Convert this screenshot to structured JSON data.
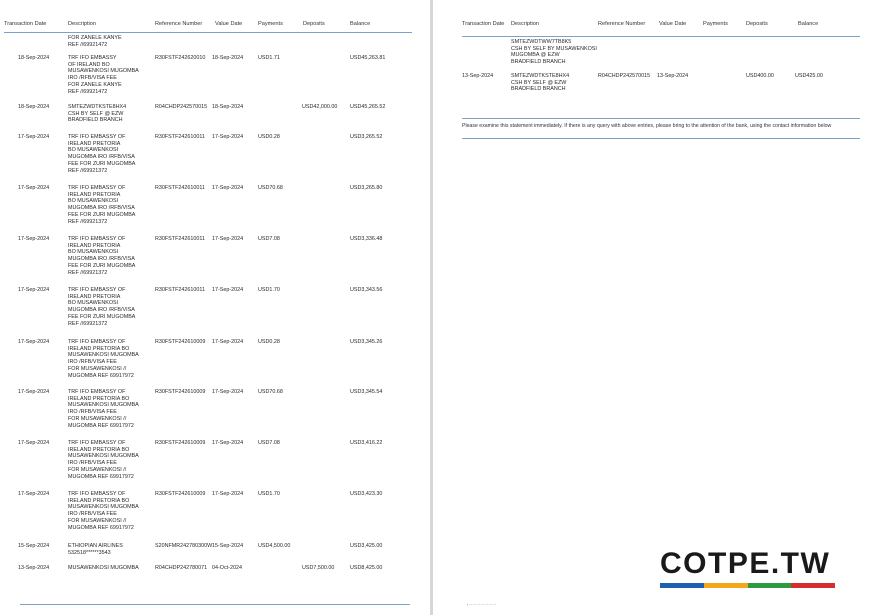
{
  "headers": {
    "date": "Transaction Date",
    "desc": "Description",
    "ref": "Reference Number",
    "value": "Value Date",
    "pay": "Payments",
    "dep": "Deposits",
    "bal": "Balance"
  },
  "left_page": {
    "continued_desc": "FOR ZANELE KANYE\nREF //69921472",
    "rows": [
      {
        "date": "18-Sep-2024",
        "desc": "TRF IFO EMBASSY\nOF IRELAND BO\nMUSAWENKOSI MUGOMBA\nIRO /RFB/VISA FEE\nFOR ZANELE KANYE\nREF //69921472",
        "ref": "R30FSTF242620010",
        "value": "18-Sep-2024",
        "pay": "USD1.71",
        "dep": "",
        "bal": "USD45,263.81"
      },
      {
        "date": "18-Sep-2024",
        "desc": "SMTEZWDTKSTE8HX4\nCSH BY SELF @ EZW\nBRADFIELD BRANCH",
        "ref": "R04CHDP242570015",
        "value": "18-Sep-2024",
        "pay": "",
        "dep": "USD42,000.00",
        "bal": "USD45,265.52"
      },
      {
        "date": "17-Sep-2024",
        "desc": "TRF IFO EMBASSY OF\nIRELAND PRETORIA\nBO MUSAWENKOSI\nMUGOMBA IRO /RFB/VISA\nFEE FOR ZURI MUGOMBA\nREF //69921372",
        "ref": "R30FSTF242610011",
        "value": "17-Sep-2024",
        "pay": "USD0.28",
        "dep": "",
        "bal": "USD3,265.52"
      },
      {
        "date": "17-Sep-2024",
        "desc": "TRF IFO EMBASSY OF\nIRELAND PRETORIA\nBO MUSAWENKOSI\nMUGOMBA IRO /RFB/VISA\nFEE FOR ZURI MUGOMBA\nREF //69921372",
        "ref": "R30FSTF242610011",
        "value": "17-Sep-2024",
        "pay": "USD70.68",
        "dep": "",
        "bal": "USD3,265.80"
      },
      {
        "date": "17-Sep-2024",
        "desc": "TRF IFO EMBASSY OF\nIRELAND PRETORIA\nBO MUSAWENKOSI\nMUGOMBA IRO /RFB/VISA\nFEE FOR ZURI MUGOMBA\nREF //69921372",
        "ref": "R30FSTF242610011",
        "value": "17-Sep-2024",
        "pay": "USD7.08",
        "dep": "",
        "bal": "USD3,336.48"
      },
      {
        "date": "17-Sep-2024",
        "desc": "TRF IFO EMBASSY OF\nIRELAND PRETORIA\nBO MUSAWENKOSI\nMUGOMBA IRO /RFB/VISA\nFEE FOR ZURI MUGOMBA\nREF //69921372",
        "ref": "R30FSTF242610011",
        "value": "17-Sep-2024",
        "pay": "USD1.70",
        "dep": "",
        "bal": "USD3,343.56"
      },
      {
        "date": "17-Sep-2024",
        "desc": "TRF IFO EMBASSY OF\nIRELAND PRETORIA BO\nMUSAWENKOSI MUGOMBA\nIRO /RFB/VISA FEE\nFOR MUSAWENKOSI //\nMUGOMBA REF 69917972",
        "ref": "R30FSTF242610009",
        "value": "17-Sep-2024",
        "pay": "USD0.28",
        "dep": "",
        "bal": "USD3,345.26"
      },
      {
        "date": "17-Sep-2024",
        "desc": "TRF IFO EMBASSY OF\nIRELAND PRETORIA BO\nMUSAWENKOSI MUGOMBA\nIRO /RFB/VISA FEE\nFOR MUSAWENKOSI //\nMUGOMBA REF 69917972",
        "ref": "R30FSTF242610009",
        "value": "17-Sep-2024",
        "pay": "USD70.68",
        "dep": "",
        "bal": "USD3,345.54"
      },
      {
        "date": "17-Sep-2024",
        "desc": "TRF IFO EMBASSY OF\nIRELAND PRETORIA BO\nMUSAWENKOSI MUGOMBA\nIRO /RFB/VISA FEE\nFOR MUSAWENKOSI //\nMUGOMBA REF 69917972",
        "ref": "R30FSTF242610009",
        "value": "17-Sep-2024",
        "pay": "USD7.08",
        "dep": "",
        "bal": "USD3,416.22"
      },
      {
        "date": "17-Sep-2024",
        "desc": "TRF IFO EMBASSY OF\nIRELAND PRETORIA BO\nMUSAWENKOSI MUGOMBA\nIRO /RFB/VISA FEE\nFOR MUSAWENKOSI //\nMUGOMBA REF 69917972",
        "ref": "R30FSTF242610009",
        "value": "17-Sep-2024",
        "pay": "USD1.70",
        "dep": "",
        "bal": "USD3,423.30"
      },
      {
        "date": "15-Sep-2024",
        "desc": "ETHIOPIAN AIRLINES\n532518******3543",
        "ref": "S20NFMR242780300W",
        "value": "15-Sep-2024",
        "pay": "USD4,500.00",
        "dep": "",
        "bal": "USD3,425.00"
      },
      {
        "date": "13-Sep-2024",
        "desc": "MUSAWENKOSI MUGOMBA",
        "ref": "R04CHDP242780071",
        "value": "04-Oct-2024",
        "pay": "",
        "dep": "USD7,500.00",
        "bal": "USD8,425.00"
      }
    ]
  },
  "right_page": {
    "continued_desc": "SMTEZWDTWW7TB8K5\nCSH BY SELF BY MUSAWENKOSI\nMUGOMBA @ EZW\nBRADFIELD BRANCH",
    "rows": [
      {
        "date": "13-Sep-2024",
        "desc": "SMTEZWDTKSTE8HX4\nCSH BY SELF @ EZW\nBRADFIELD BRANCH",
        "ref": "R04CHDP242570015",
        "value": "13-Sep-2024",
        "pay": "",
        "dep": "USD400.00",
        "bal": "USD425.00"
      }
    ],
    "note": "Please examine this statement immediately. If there is any query with above entries, please bring to the attention of the bank, using the contact information below"
  },
  "watermark": {
    "text": "COTPE.TW",
    "bar_colors": [
      "#1f5fb0",
      "#f2a81d",
      "#2e9a3f",
      "#d62e2e"
    ]
  },
  "colors": {
    "rule": "#7aa3c7",
    "page": "#ffffff",
    "gutter": "#d7d7d7"
  }
}
